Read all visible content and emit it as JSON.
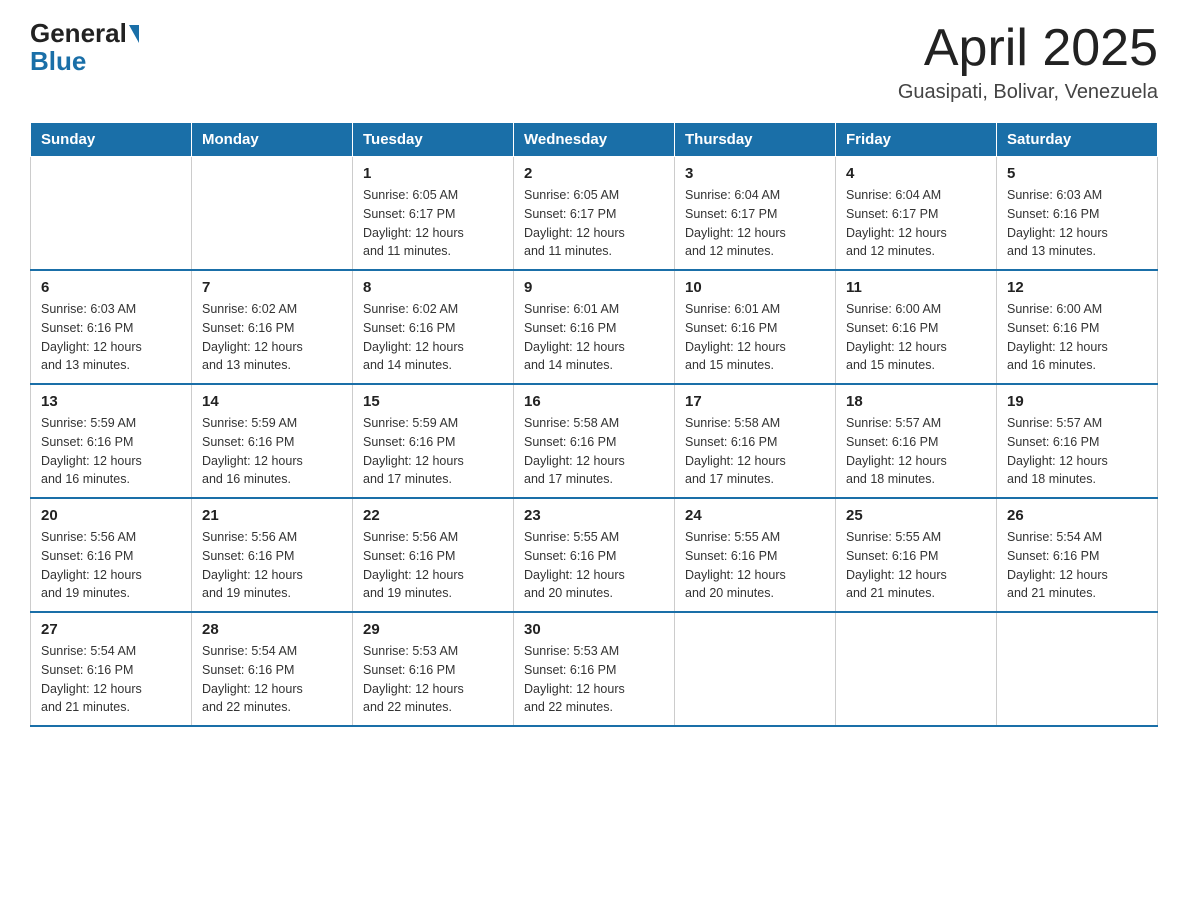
{
  "header": {
    "logo_general": "General",
    "logo_blue": "Blue",
    "title": "April 2025",
    "subtitle": "Guasipati, Bolivar, Venezuela"
  },
  "calendar": {
    "days_of_week": [
      "Sunday",
      "Monday",
      "Tuesday",
      "Wednesday",
      "Thursday",
      "Friday",
      "Saturday"
    ],
    "weeks": [
      [
        {
          "day": "",
          "info": ""
        },
        {
          "day": "",
          "info": ""
        },
        {
          "day": "1",
          "info": "Sunrise: 6:05 AM\nSunset: 6:17 PM\nDaylight: 12 hours\nand 11 minutes."
        },
        {
          "day": "2",
          "info": "Sunrise: 6:05 AM\nSunset: 6:17 PM\nDaylight: 12 hours\nand 11 minutes."
        },
        {
          "day": "3",
          "info": "Sunrise: 6:04 AM\nSunset: 6:17 PM\nDaylight: 12 hours\nand 12 minutes."
        },
        {
          "day": "4",
          "info": "Sunrise: 6:04 AM\nSunset: 6:17 PM\nDaylight: 12 hours\nand 12 minutes."
        },
        {
          "day": "5",
          "info": "Sunrise: 6:03 AM\nSunset: 6:16 PM\nDaylight: 12 hours\nand 13 minutes."
        }
      ],
      [
        {
          "day": "6",
          "info": "Sunrise: 6:03 AM\nSunset: 6:16 PM\nDaylight: 12 hours\nand 13 minutes."
        },
        {
          "day": "7",
          "info": "Sunrise: 6:02 AM\nSunset: 6:16 PM\nDaylight: 12 hours\nand 13 minutes."
        },
        {
          "day": "8",
          "info": "Sunrise: 6:02 AM\nSunset: 6:16 PM\nDaylight: 12 hours\nand 14 minutes."
        },
        {
          "day": "9",
          "info": "Sunrise: 6:01 AM\nSunset: 6:16 PM\nDaylight: 12 hours\nand 14 minutes."
        },
        {
          "day": "10",
          "info": "Sunrise: 6:01 AM\nSunset: 6:16 PM\nDaylight: 12 hours\nand 15 minutes."
        },
        {
          "day": "11",
          "info": "Sunrise: 6:00 AM\nSunset: 6:16 PM\nDaylight: 12 hours\nand 15 minutes."
        },
        {
          "day": "12",
          "info": "Sunrise: 6:00 AM\nSunset: 6:16 PM\nDaylight: 12 hours\nand 16 minutes."
        }
      ],
      [
        {
          "day": "13",
          "info": "Sunrise: 5:59 AM\nSunset: 6:16 PM\nDaylight: 12 hours\nand 16 minutes."
        },
        {
          "day": "14",
          "info": "Sunrise: 5:59 AM\nSunset: 6:16 PM\nDaylight: 12 hours\nand 16 minutes."
        },
        {
          "day": "15",
          "info": "Sunrise: 5:59 AM\nSunset: 6:16 PM\nDaylight: 12 hours\nand 17 minutes."
        },
        {
          "day": "16",
          "info": "Sunrise: 5:58 AM\nSunset: 6:16 PM\nDaylight: 12 hours\nand 17 minutes."
        },
        {
          "day": "17",
          "info": "Sunrise: 5:58 AM\nSunset: 6:16 PM\nDaylight: 12 hours\nand 17 minutes."
        },
        {
          "day": "18",
          "info": "Sunrise: 5:57 AM\nSunset: 6:16 PM\nDaylight: 12 hours\nand 18 minutes."
        },
        {
          "day": "19",
          "info": "Sunrise: 5:57 AM\nSunset: 6:16 PM\nDaylight: 12 hours\nand 18 minutes."
        }
      ],
      [
        {
          "day": "20",
          "info": "Sunrise: 5:56 AM\nSunset: 6:16 PM\nDaylight: 12 hours\nand 19 minutes."
        },
        {
          "day": "21",
          "info": "Sunrise: 5:56 AM\nSunset: 6:16 PM\nDaylight: 12 hours\nand 19 minutes."
        },
        {
          "day": "22",
          "info": "Sunrise: 5:56 AM\nSunset: 6:16 PM\nDaylight: 12 hours\nand 19 minutes."
        },
        {
          "day": "23",
          "info": "Sunrise: 5:55 AM\nSunset: 6:16 PM\nDaylight: 12 hours\nand 20 minutes."
        },
        {
          "day": "24",
          "info": "Sunrise: 5:55 AM\nSunset: 6:16 PM\nDaylight: 12 hours\nand 20 minutes."
        },
        {
          "day": "25",
          "info": "Sunrise: 5:55 AM\nSunset: 6:16 PM\nDaylight: 12 hours\nand 21 minutes."
        },
        {
          "day": "26",
          "info": "Sunrise: 5:54 AM\nSunset: 6:16 PM\nDaylight: 12 hours\nand 21 minutes."
        }
      ],
      [
        {
          "day": "27",
          "info": "Sunrise: 5:54 AM\nSunset: 6:16 PM\nDaylight: 12 hours\nand 21 minutes."
        },
        {
          "day": "28",
          "info": "Sunrise: 5:54 AM\nSunset: 6:16 PM\nDaylight: 12 hours\nand 22 minutes."
        },
        {
          "day": "29",
          "info": "Sunrise: 5:53 AM\nSunset: 6:16 PM\nDaylight: 12 hours\nand 22 minutes."
        },
        {
          "day": "30",
          "info": "Sunrise: 5:53 AM\nSunset: 6:16 PM\nDaylight: 12 hours\nand 22 minutes."
        },
        {
          "day": "",
          "info": ""
        },
        {
          "day": "",
          "info": ""
        },
        {
          "day": "",
          "info": ""
        }
      ]
    ]
  }
}
